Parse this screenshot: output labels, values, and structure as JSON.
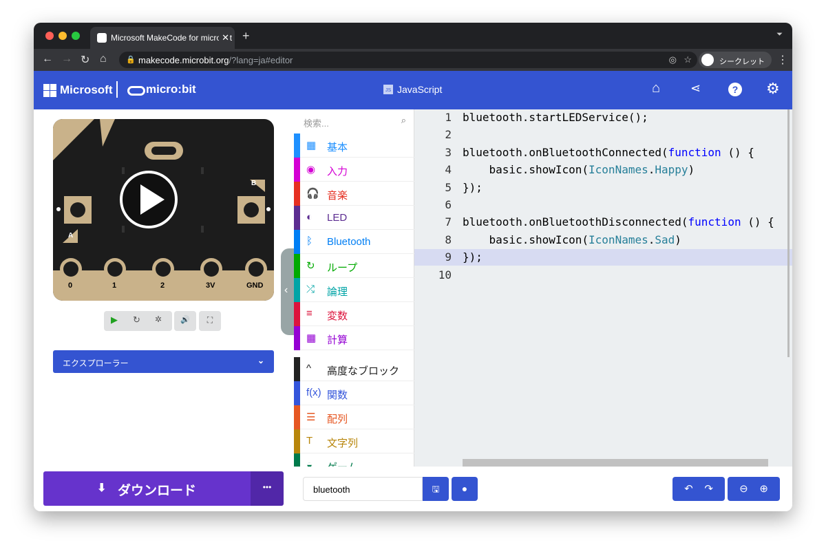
{
  "browser": {
    "tab_title": "Microsoft MakeCode for micro:bit",
    "url_host": "makecode.microbit.org",
    "url_rest": "/?lang=ja#editor",
    "profile": "シークレット"
  },
  "header": {
    "brand": "Microsoft",
    "product": "micro:bit",
    "mode": "JavaScript"
  },
  "simulator": {
    "pins": [
      "0",
      "1",
      "2",
      "3V",
      "GND"
    ],
    "button_a": "A",
    "button_b": "B"
  },
  "explorer": {
    "label": "エクスプローラー"
  },
  "toolbox": {
    "search_placeholder": "検索...",
    "categories": [
      {
        "label": "基本",
        "color": "#1e90ff",
        "icon": "▦"
      },
      {
        "label": "入力",
        "color": "#d400d4",
        "icon": "◉"
      },
      {
        "label": "音楽",
        "color": "#e63022",
        "icon": "🎧"
      },
      {
        "label": "LED",
        "color": "#5c2d91",
        "icon": "◐"
      },
      {
        "label": "Bluetooth",
        "color": "#007eF4",
        "icon": "ᛒ"
      },
      {
        "label": "ループ",
        "color": "#00aa00",
        "icon": "↻"
      },
      {
        "label": "論理",
        "color": "#00a4a6",
        "icon": "⤮"
      },
      {
        "label": "変数",
        "color": "#dc143c",
        "icon": "≡"
      },
      {
        "label": "計算",
        "color": "#9400d3",
        "icon": "▦"
      },
      {
        "label": "高度なブロック",
        "color": "#222222",
        "icon": "^"
      },
      {
        "label": "関数",
        "color": "#3455db",
        "icon": "f(x)"
      },
      {
        "label": "配列",
        "color": "#e65722",
        "icon": "☰"
      },
      {
        "label": "文字列",
        "color": "#b8860b",
        "icon": "T"
      },
      {
        "label": "ゲーム",
        "color": "#007a4b",
        "icon": "◒"
      }
    ]
  },
  "editor": {
    "lines": [
      "bluetooth.startLEDService();",
      "",
      "bluetooth.onBluetoothConnected(function () {",
      "    basic.showIcon(IconNames.Happy)",
      "});",
      "",
      "bluetooth.onBluetoothDisconnected(function () {",
      "    basic.showIcon(IconNames.Sad)",
      "});",
      ""
    ],
    "highlighted_line": 9
  },
  "footer": {
    "download": "ダウンロード",
    "more": "•••",
    "project_name": "bluetooth"
  }
}
